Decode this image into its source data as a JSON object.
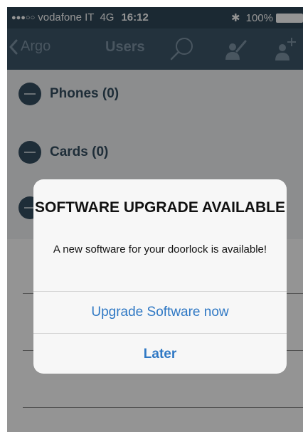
{
  "status_bar": {
    "signal": "●●●○○",
    "carrier": "vodafone IT",
    "network": "4G",
    "time": "16:12",
    "bluetooth_icon": "bluetooth-icon",
    "battery": "100%"
  },
  "nav": {
    "back_label": "Argo",
    "title": "Users",
    "icons": [
      "search-icon",
      "edit-user-icon",
      "add-user-icon"
    ]
  },
  "list": {
    "items": [
      {
        "label": "Phones (0)"
      },
      {
        "label": "Cards (0)"
      }
    ]
  },
  "alert": {
    "title": "SOFTWARE UPGRADE AVAILABLE",
    "message": "A new software for your doorlock is available!",
    "primary_button": "Upgrade Software now",
    "secondary_button": "Later"
  },
  "colors": {
    "navbar": "#3d5669",
    "accent": "#354e61",
    "button_text": "#2f78c4"
  }
}
